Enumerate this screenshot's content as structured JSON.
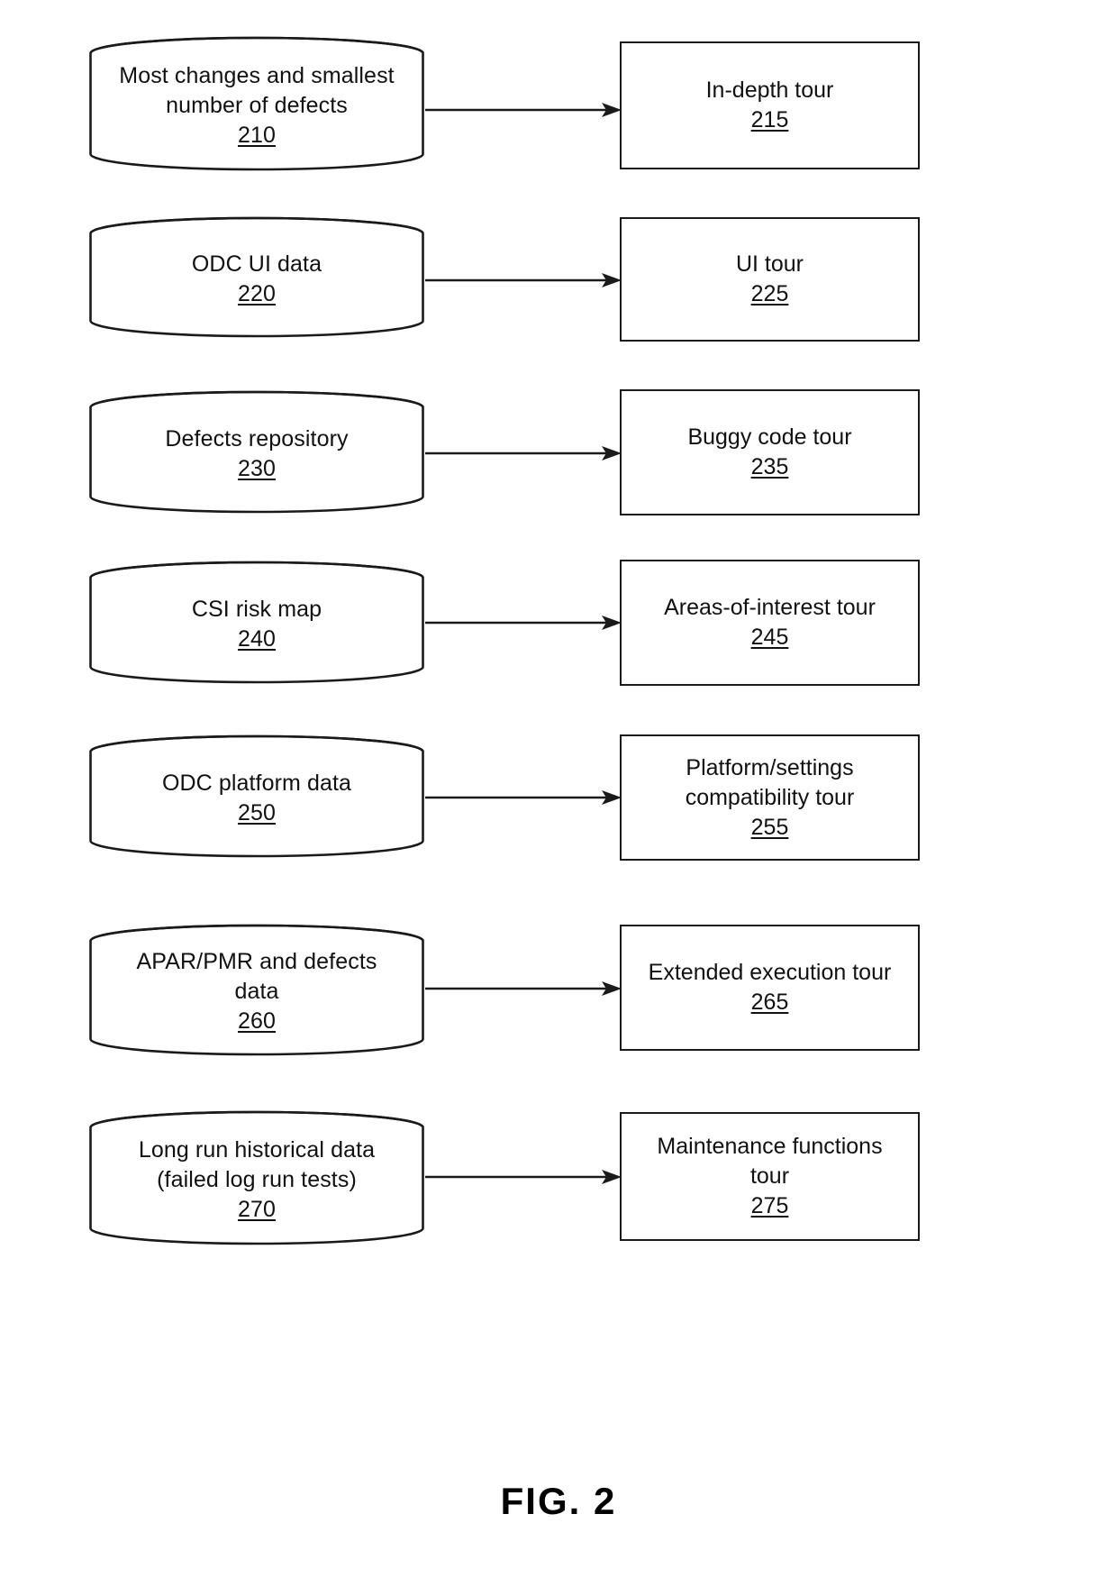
{
  "figure": {
    "caption": "FIG. 2",
    "rows": [
      {
        "source": {
          "lines": [
            "Most changes and smallest",
            "number of defects"
          ],
          "ref": "210"
        },
        "target": {
          "lines": [
            "In-depth tour"
          ],
          "ref": "215"
        }
      },
      {
        "source": {
          "lines": [
            "ODC UI data"
          ],
          "ref": "220"
        },
        "target": {
          "lines": [
            "UI tour"
          ],
          "ref": "225"
        }
      },
      {
        "source": {
          "lines": [
            "Defects repository"
          ],
          "ref": "230"
        },
        "target": {
          "lines": [
            "Buggy code tour"
          ],
          "ref": "235"
        }
      },
      {
        "source": {
          "lines": [
            "CSI risk map"
          ],
          "ref": "240"
        },
        "target": {
          "lines": [
            "Areas-of-interest tour"
          ],
          "ref": "245"
        }
      },
      {
        "source": {
          "lines": [
            "ODC platform data"
          ],
          "ref": "250"
        },
        "target": {
          "lines": [
            "Platform/settings",
            "compatibility tour"
          ],
          "ref": "255"
        }
      },
      {
        "source": {
          "lines": [
            "APAR/PMR and defects",
            "data"
          ],
          "ref": "260"
        },
        "target": {
          "lines": [
            "Extended execution tour"
          ],
          "ref": "265"
        }
      },
      {
        "source": {
          "lines": [
            "Long run historical data",
            "(failed log run tests)"
          ],
          "ref": "270"
        },
        "target": {
          "lines": [
            "Maintenance functions",
            "tour"
          ],
          "ref": "275"
        }
      }
    ]
  },
  "style": {
    "stroke": "#1a1a1a",
    "background": "#ffffff"
  }
}
